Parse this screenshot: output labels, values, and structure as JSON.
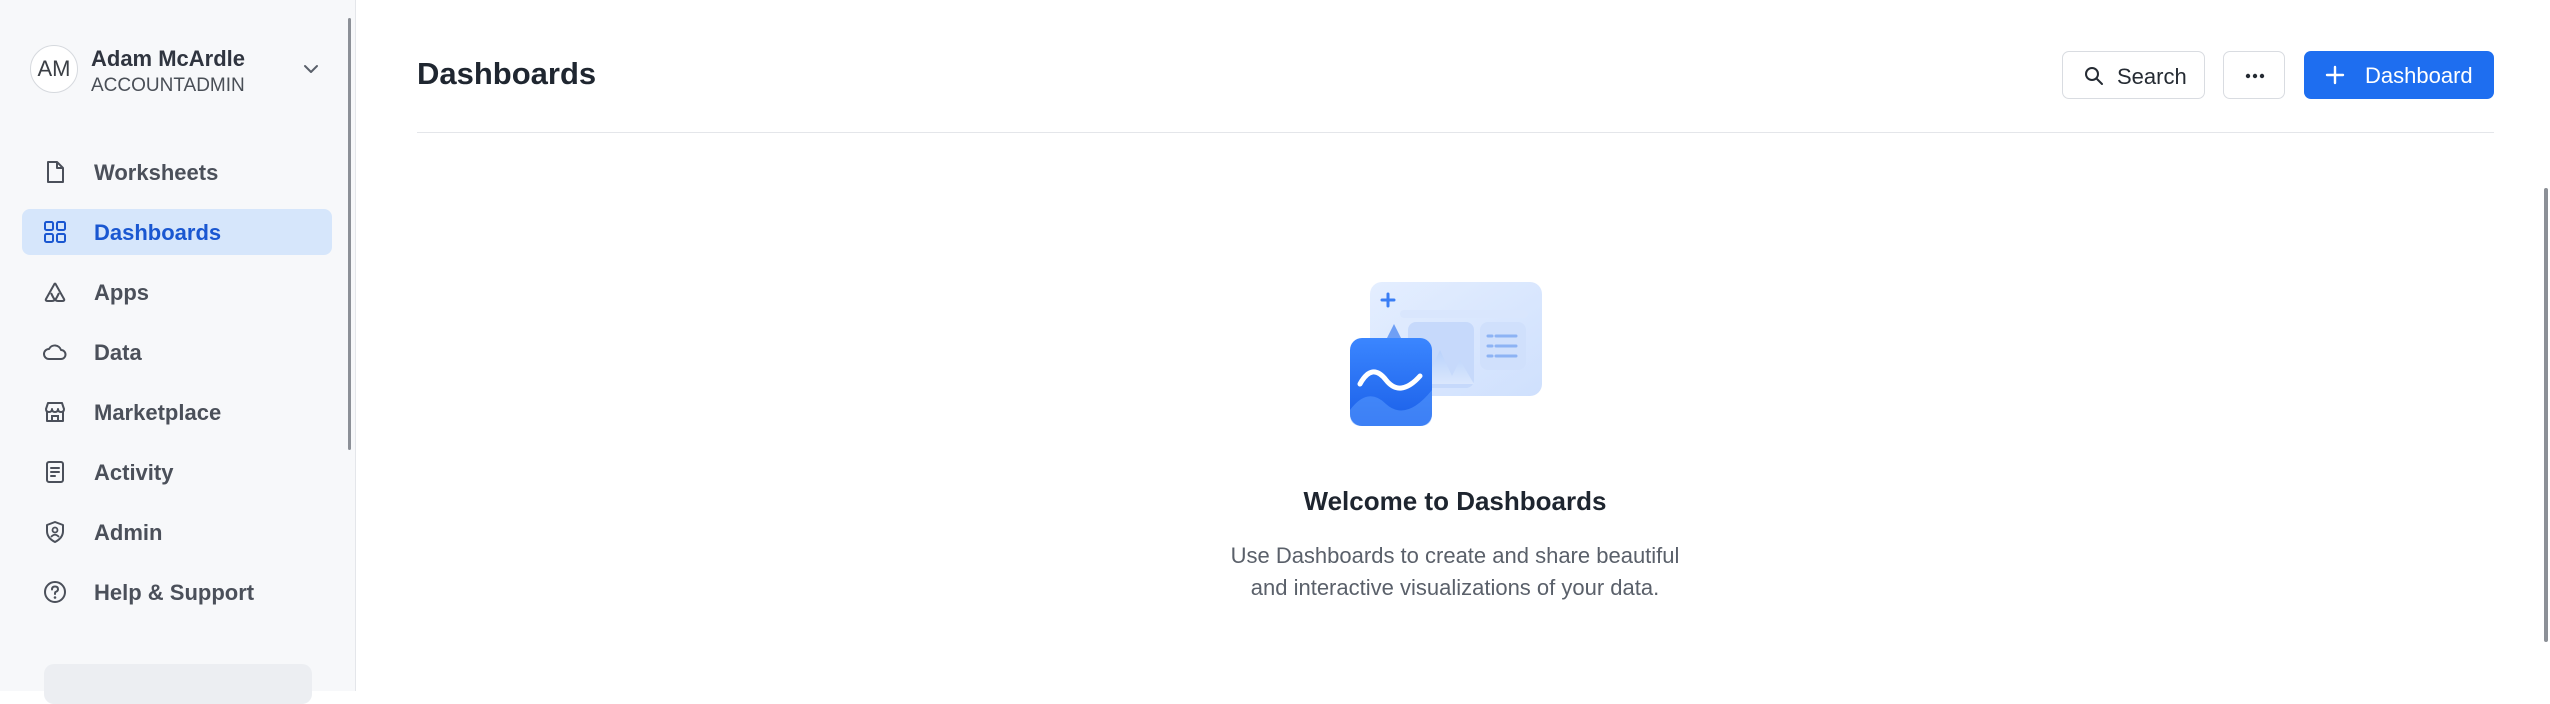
{
  "user": {
    "initials": "AM",
    "name": "Adam McArdle",
    "role": "ACCOUNTADMIN",
    "chevron_icon": "chevron-down-icon"
  },
  "nav": {
    "items": [
      {
        "label": "Worksheets",
        "icon": "document-icon",
        "active": false
      },
      {
        "label": "Dashboards",
        "icon": "grid-icon",
        "active": true
      },
      {
        "label": "Apps",
        "icon": "apps-icon",
        "active": false
      },
      {
        "label": "Data",
        "icon": "cloud-icon",
        "active": false
      },
      {
        "label": "Marketplace",
        "icon": "storefront-icon",
        "active": false
      },
      {
        "label": "Activity",
        "icon": "activity-icon",
        "active": false
      },
      {
        "label": "Admin",
        "icon": "shield-icon",
        "active": false
      },
      {
        "label": "Help & Support",
        "icon": "help-icon",
        "active": false
      }
    ]
  },
  "header": {
    "title": "Dashboards",
    "search_label": "Search",
    "more_icon": "ellipsis-icon",
    "add_label": "Dashboard"
  },
  "empty_state": {
    "title": "Welcome to Dashboards",
    "description_line1": "Use Dashboards to create and share beautiful",
    "description_line2": "and interactive visualizations of your data."
  },
  "colors": {
    "accent": "#1e6ef0",
    "active_nav_bg": "#d6e6fb",
    "active_nav_text": "#1a57d1",
    "sidebar_bg": "#f7f8fa"
  }
}
